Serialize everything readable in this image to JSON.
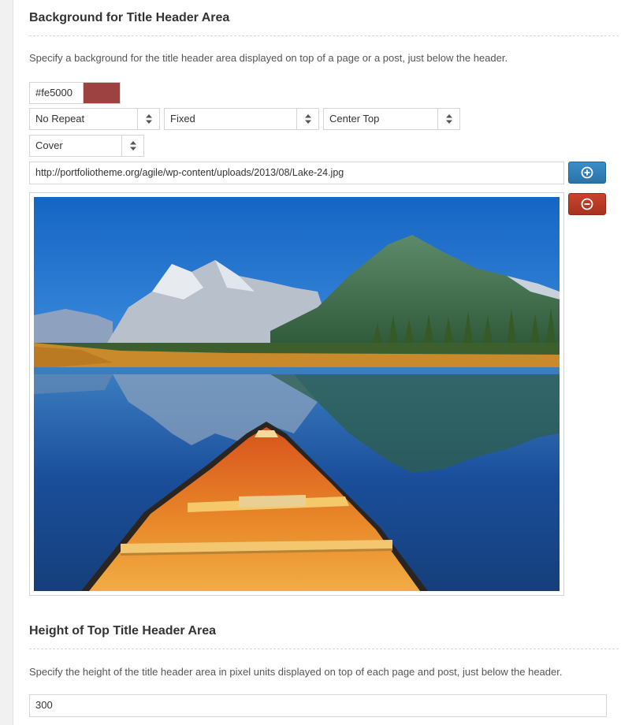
{
  "background_section": {
    "title": "Background for Title Header Area",
    "description": "Specify a background for the title header area displayed on top of a page or a post, just below the header.",
    "color_value": "#fe5000",
    "swatch_color": "#9c4341",
    "repeat_select": {
      "selected": "No Repeat"
    },
    "attachment_select": {
      "selected": "Fixed"
    },
    "position_select": {
      "selected": "Center Top"
    },
    "size_select": {
      "selected": "Cover"
    },
    "image_url": "http://portfoliotheme.org/agile/wp-content/uploads/2013/08/Lake-24.jpg",
    "add_button_icon": "plus-circle-icon",
    "remove_button_icon": "minus-circle-icon",
    "preview_image_icon": "lake-canoe-photo"
  },
  "height_section": {
    "title": "Height of Top Title Header Area",
    "description": "Specify the height of the title header area in pixel units displayed on top of each page and post, just below the header.",
    "height_value": "300"
  },
  "colors": {
    "add_button": "#2f80b9",
    "remove_button": "#b63a25"
  }
}
